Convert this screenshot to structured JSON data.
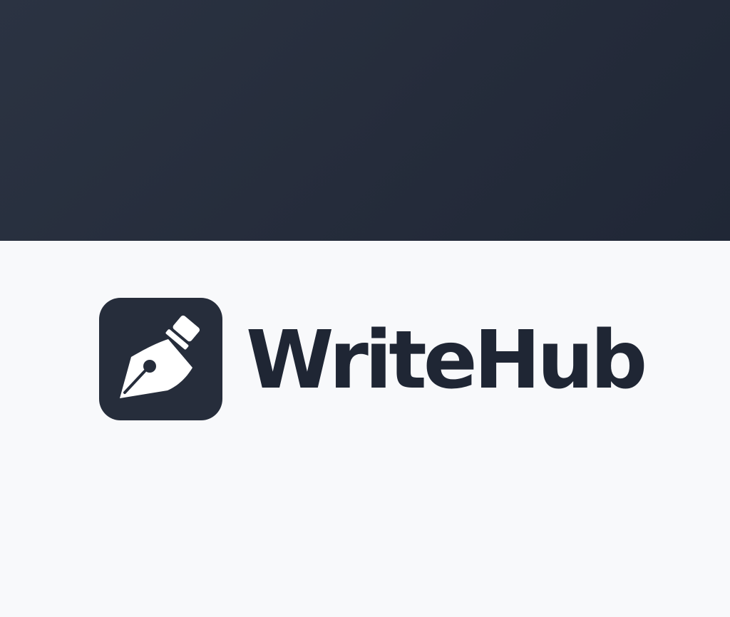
{
  "brand": {
    "name": "WriteHub",
    "icon": "fountain-pen-nib-icon",
    "colors": {
      "header_background": "#262d3b",
      "page_background": "#f8f9fb",
      "icon_background": "#262d3b",
      "icon_glyph": "#ffffff",
      "wordmark": "#1f2634"
    }
  }
}
